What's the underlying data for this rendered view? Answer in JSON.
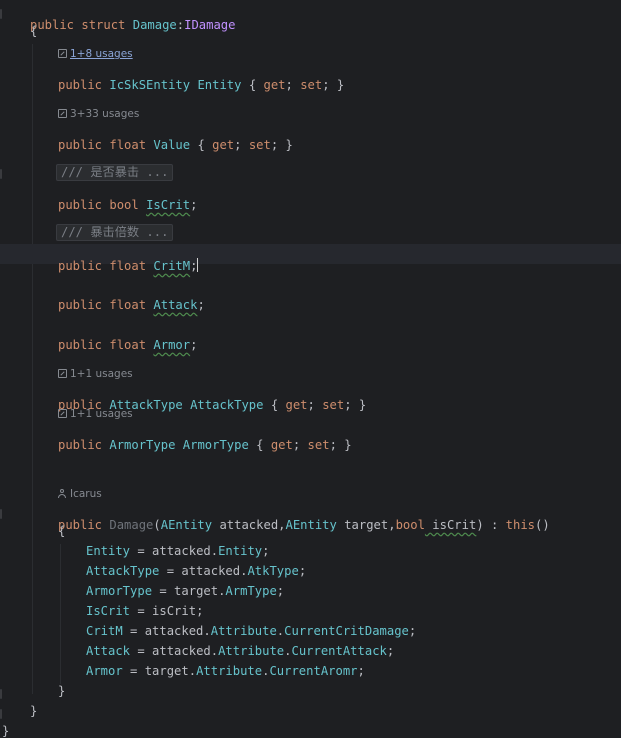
{
  "code": {
    "line1": {
      "kw1": "public",
      "kw2": "struct",
      "name": "Damage",
      "sep": ":",
      "iface": "IDamage"
    },
    "brace_open": "{",
    "entity_hint": "1+8 usages",
    "entity": {
      "kw": "public",
      "type": "IcSkSEntity",
      "name": "Entity",
      "b1": "{ ",
      "get": "get",
      "semi1": "; ",
      "set": "set",
      "semi2": "; }"
    },
    "value_hint": "3+33 usages",
    "value": {
      "kw": "public",
      "type": "float",
      "name": "Value",
      "b1": "{ ",
      "get": "get",
      "semi1": "; ",
      "set": "set",
      "semi2": "; }"
    },
    "iscrit_doc": "/// 是否暴击 ...",
    "iscrit": {
      "kw": "public",
      "type": "bool",
      "name": "IsCrit",
      "end": ";"
    },
    "critm_doc": "/// 暴击倍数 ...",
    "critm": {
      "kw": "public",
      "type": "float",
      "name": "CritM",
      "end": ";"
    },
    "attack": {
      "kw": "public",
      "type": "float",
      "name": "Attack",
      "end": ";"
    },
    "armor": {
      "kw": "public",
      "type": "float",
      "name": "Armor",
      "end": ";"
    },
    "attacktype_hint": "1+1 usages",
    "attacktype": {
      "kw": "public",
      "type": "AttackType",
      "name": "AttackType",
      "b1": "{ ",
      "get": "get",
      "semi1": "; ",
      "set": "set",
      "semi2": "; }"
    },
    "armortype_hint": "1+1 usages",
    "armortype": {
      "kw": "public",
      "type": "ArmorType",
      "name": "ArmorType",
      "b1": "{ ",
      "get": "get",
      "semi1": "; ",
      "set": "set",
      "semi2": "; }"
    },
    "author_hint": "Icarus",
    "ctor": {
      "kw": "public",
      "name": "Damage",
      "p1type": "AEntity",
      "p1": " attacked,",
      "p2type": "AEntity",
      "p2": " target,",
      "p3type": "bool",
      "p3": " isCrit",
      "close": ") : ",
      "this": "this",
      "end": "()"
    },
    "ctor_open": "{",
    "assign1": {
      "lhs": "Entity",
      "op": " = attacked.",
      "rhs": "Entity",
      "end": ";"
    },
    "assign2": {
      "lhs": "AttackType",
      "op": " = attacked.",
      "rhs": "AtkType",
      "end": ";"
    },
    "assign3": {
      "lhs": "ArmorType",
      "op": " = target.",
      "rhs": "ArmType",
      "end": ";"
    },
    "assign4": {
      "lhs": "IsCrit",
      "op": " = isCrit;"
    },
    "assign5": {
      "lhs": "CritM",
      "op": " = attacked.",
      "mid": "Attribute",
      "dot": ".",
      "rhs": "CurrentCritDamage",
      "end": ";"
    },
    "assign6": {
      "lhs": "Attack",
      "op": " = attacked.",
      "mid": "Attribute",
      "dot": ".",
      "rhs": "CurrentAttack",
      "end": ";"
    },
    "assign7": {
      "lhs": "Armor",
      "op": " = target.",
      "mid": "Attribute",
      "dot": ".",
      "rhs": "CurrentAromr",
      "end": ";"
    },
    "ctor_close": "}",
    "struct_close": "}",
    "file_close": "}"
  },
  "colors": {
    "background": "#1e1f22",
    "keyword": "#cf8e6d",
    "type": "#c191ff",
    "member": "#66c3cc",
    "hint": "#868a91"
  }
}
